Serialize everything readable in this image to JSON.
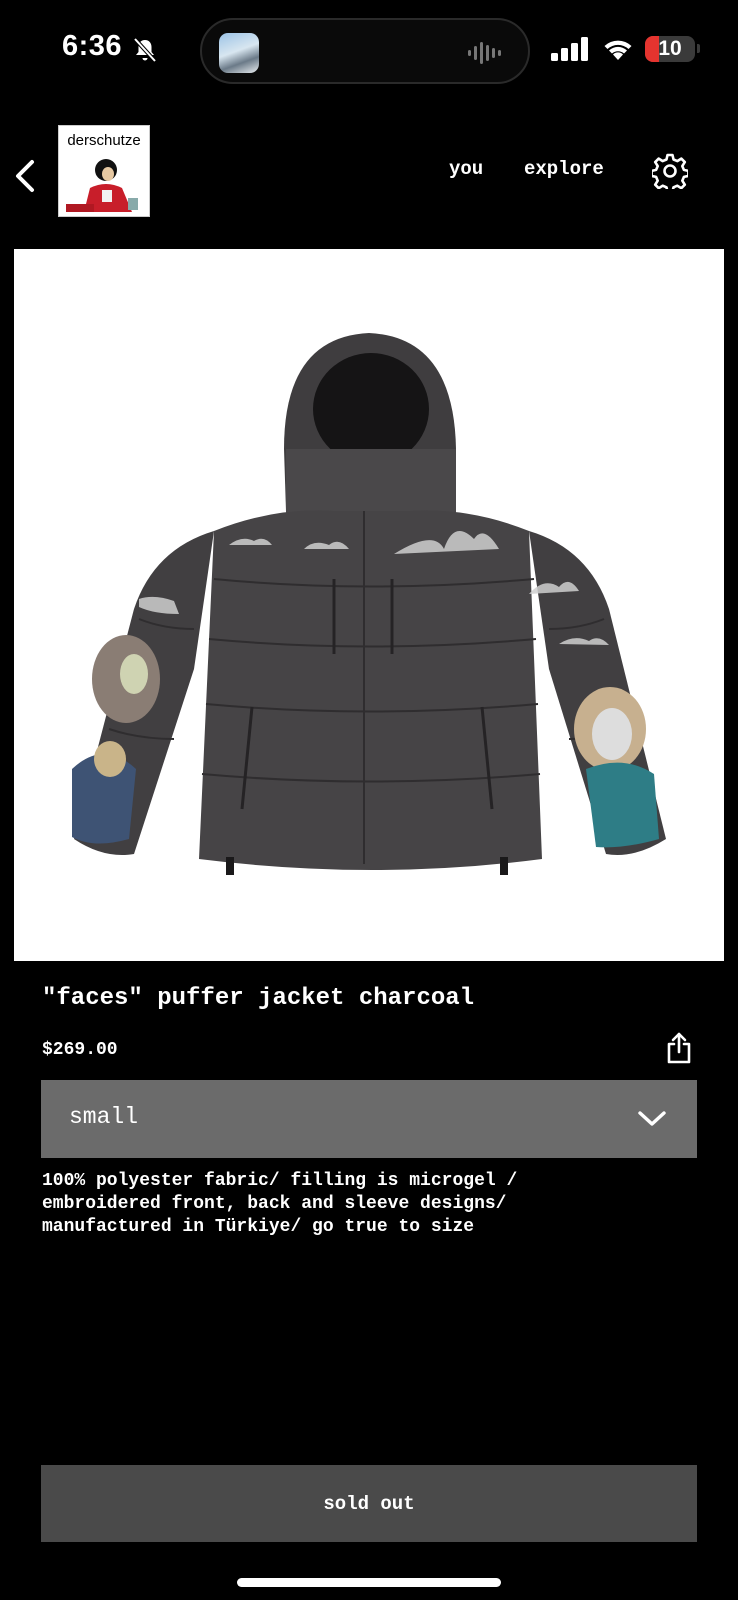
{
  "status_bar": {
    "time": "6:36",
    "battery": "10",
    "colors": {
      "battery_low": "#e5342f"
    },
    "icons": [
      "bell-slash-icon",
      "waveform-icon",
      "signal-icon",
      "wifi-icon",
      "battery-icon"
    ]
  },
  "header": {
    "brand": "derschutze",
    "nav": {
      "you": "you",
      "explore": "explore"
    },
    "icons": [
      "chevron-left-icon",
      "gear-icon"
    ]
  },
  "product": {
    "title": "\"faces\" puffer jacket charcoal",
    "price": "$269.00",
    "size_selected": "small",
    "description": "100% polyester fabric/ filling is microgel /\nembroidered front, back and sleeve designs/\nmanufactured in Türkiye/ go true to size",
    "button": "sold out",
    "icons": [
      "share-icon",
      "chevron-down-icon"
    ]
  }
}
